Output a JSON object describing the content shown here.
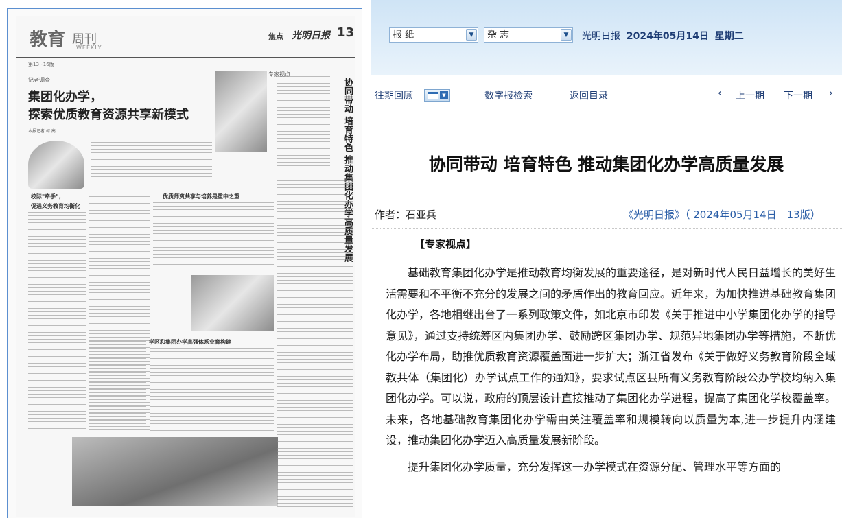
{
  "newspaper_page": {
    "masthead_title": "教育",
    "masthead_weekly": "周刊",
    "masthead_weekly_en": "WEEKLY",
    "pages_label": "第13~16版",
    "focus_label": "焦点",
    "brand": "光明日报",
    "page_number": "13",
    "section_reporter": "记者调查",
    "headline_line1": "集团化办学，",
    "headline_line2": "探索优质教育资源共享新模式",
    "byline": "本报记者 柯 高",
    "column_label": "专家视点",
    "vertical_title": "协同带动 培育特色 推动集团化办学高质量发展",
    "subheads": [
      "校际\"牵手\"，",
      "促进义务教育均衡化",
      "优质师资共享与培养是重中之重",
      "学区和集团办学高强体系业育构建"
    ]
  },
  "toolbar": {
    "paper_select": "报纸",
    "magazine_select": "杂志",
    "date_prefix": "光明日报",
    "date": "2024年05月14日",
    "weekday": "星期二"
  },
  "nav": {
    "past_issues": "往期回顾",
    "digital_search": "数字报检索",
    "back_to_index": "返回目录",
    "prev_arrow": "‹",
    "prev_issue": "上一期",
    "next_issue": "下一期",
    "next_arrow": "›"
  },
  "article": {
    "title": "协同带动 培育特色 推动集团化办学高质量发展",
    "author": "作者：石亚兵",
    "source": "《光明日报》（ 2024年05月14日　13版）",
    "section": "【专家视点】",
    "paragraphs": [
      "基础教育集团化办学是推动教育均衡发展的重要途径，是对新时代人民日益增长的美好生活需要和不平衡不充分的发展之间的矛盾作出的教育回应。近年来，为加快推进基础教育集团化办学，各地相继出台了一系列政策文件，如北京市印发《关于推进中小学集团化办学的指导意见》，通过支持统筹区内集团办学、鼓励跨区集团办学、规范异地集团办学等措施，不断优化办学布局，助推优质教育资源覆盖面进一步扩大；浙江省发布《关于做好义务教育阶段全域教共体（集团化）办学试点工作的通知》，要求试点区县所有义务教育阶段公办学校均纳入集团化办学。可以说，政府的顶层设计直接推动了集团化办学进程，提高了集团化学校覆盖率。未来，各地基础教育集团化办学需由关注覆盖率和规模转向以质量为本,进一步提升内涵建设，推动集团化办学迈入高质量发展新阶段。",
      "提升集团化办学质量，充分发挥这一办学模式在资源分配、管理水平等方面的"
    ]
  }
}
